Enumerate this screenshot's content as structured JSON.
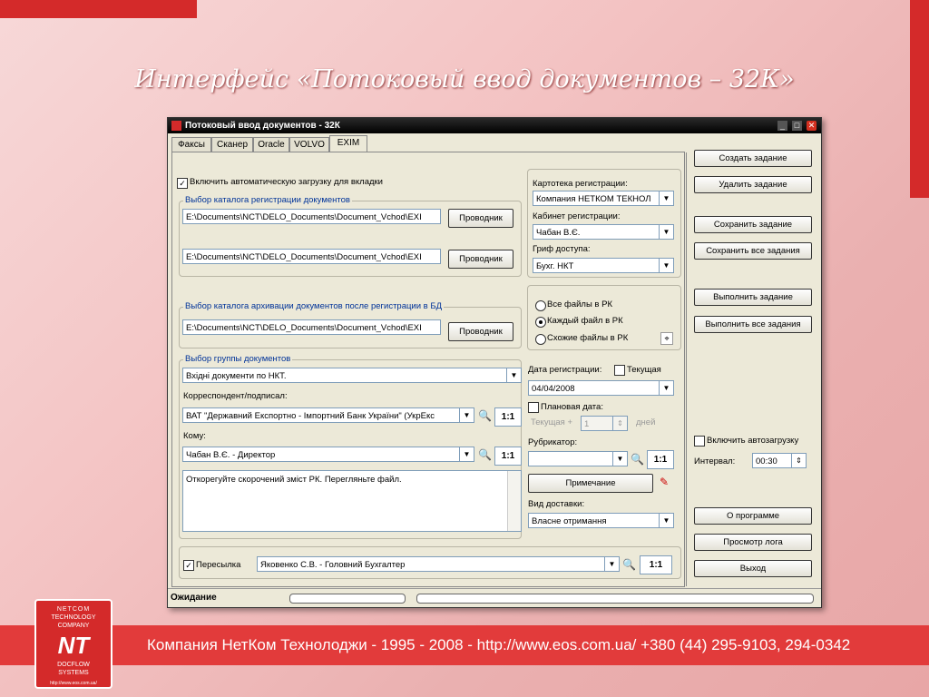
{
  "slide_title": "Интерфейс «Потоковый ввод документов – 32К»",
  "footer": "Компания НетКом Технолоджи - 1995 - 2008 - http://www.eos.com.ua/ +380 (44) 295-9103, 294-0342",
  "logo": {
    "line1": "NETCOM",
    "line2": "TECHNOLOGY",
    "line3": "COMPANY",
    "mark": "NT",
    "line4": "DOCFLOW",
    "line5": "SYSTEMS",
    "url": "http://www.eos.com.ua/"
  },
  "window": {
    "title": "Потоковый ввод документов - 32К",
    "tabs": [
      "Факсы",
      "Сканер",
      "Oracle",
      "VOLVO",
      "EXIM"
    ],
    "auto_load_label": "Включить автоматическую загрузку для вкладки",
    "reg_catalog_legend": "Выбор каталога регистрации документов",
    "path1": "E:\\Documents\\NCT\\DELO_Documents\\Document_Vchod\\EXI",
    "path2": "E:\\Documents\\NCT\\DELO_Documents\\Document_Vchod\\EXI",
    "archive_legend": "Выбор каталога архивации документов после регистрации в БД",
    "path3": "E:\\Documents\\NCT\\DELO_Documents\\Document_Vchod\\EXI",
    "explorer_btn": "Проводник",
    "kartoteka_label": "Картотека регистрации:",
    "kartoteka_value": "Компания НЕТКОМ ТЕКНОЛ",
    "cabinet_label": "Кабинет регистрации:",
    "cabinet_value": "Чабан В.Є.",
    "grif_label": "Гриф доступа:",
    "grif_value": "Бухг. НКТ",
    "radio_all": "Все файлы в РК",
    "radio_each": "Каждый файл в РК",
    "radio_similar": "Схожие файлы в РК",
    "doc_group_legend": "Выбор группы документов",
    "doc_group_value": "Вхідні документи по НКТ.",
    "corr_label": "Корреспондент/подписал:",
    "corr_value": "ВАТ \"Державний Експортно - Імпортний Банк України\" (УкрЕкс",
    "ratio": "1:1",
    "komu_label": "Кому:",
    "komu_value": "Чабан В.Є. - Директор",
    "summary_text": "Откорегуйте скорочений зміст РК. Перегляньте файл.",
    "reg_date_label": "Дата регистрации:",
    "current_label": "Текущая",
    "reg_date_value": "04/04/2008",
    "plan_date_label": "Плановая дата:",
    "current_plus_label": "Текущая +",
    "days_value": "1",
    "days_label": "дней",
    "rubricator_label": "Рубрикатор:",
    "note_btn": "Примечание",
    "delivery_label": "Вид доставки:",
    "delivery_value": "Власне отримання",
    "forward_label": "Пересылка",
    "forward_value": "Яковенко С.В. - Головний Бухгалтер",
    "buttons": {
      "create": "Создать задание",
      "delete": "Удалить задание",
      "save": "Сохранить задание",
      "save_all": "Сохранить все задания",
      "run": "Выполнить задание",
      "run_all": "Выполнить все задания",
      "about": "О программе",
      "log": "Просмотр лога",
      "exit": "Выход"
    },
    "autoload_label": "Включить автозагрузку",
    "interval_label": "Интервал:",
    "interval_value": "00:30",
    "status": "Ожидание"
  }
}
